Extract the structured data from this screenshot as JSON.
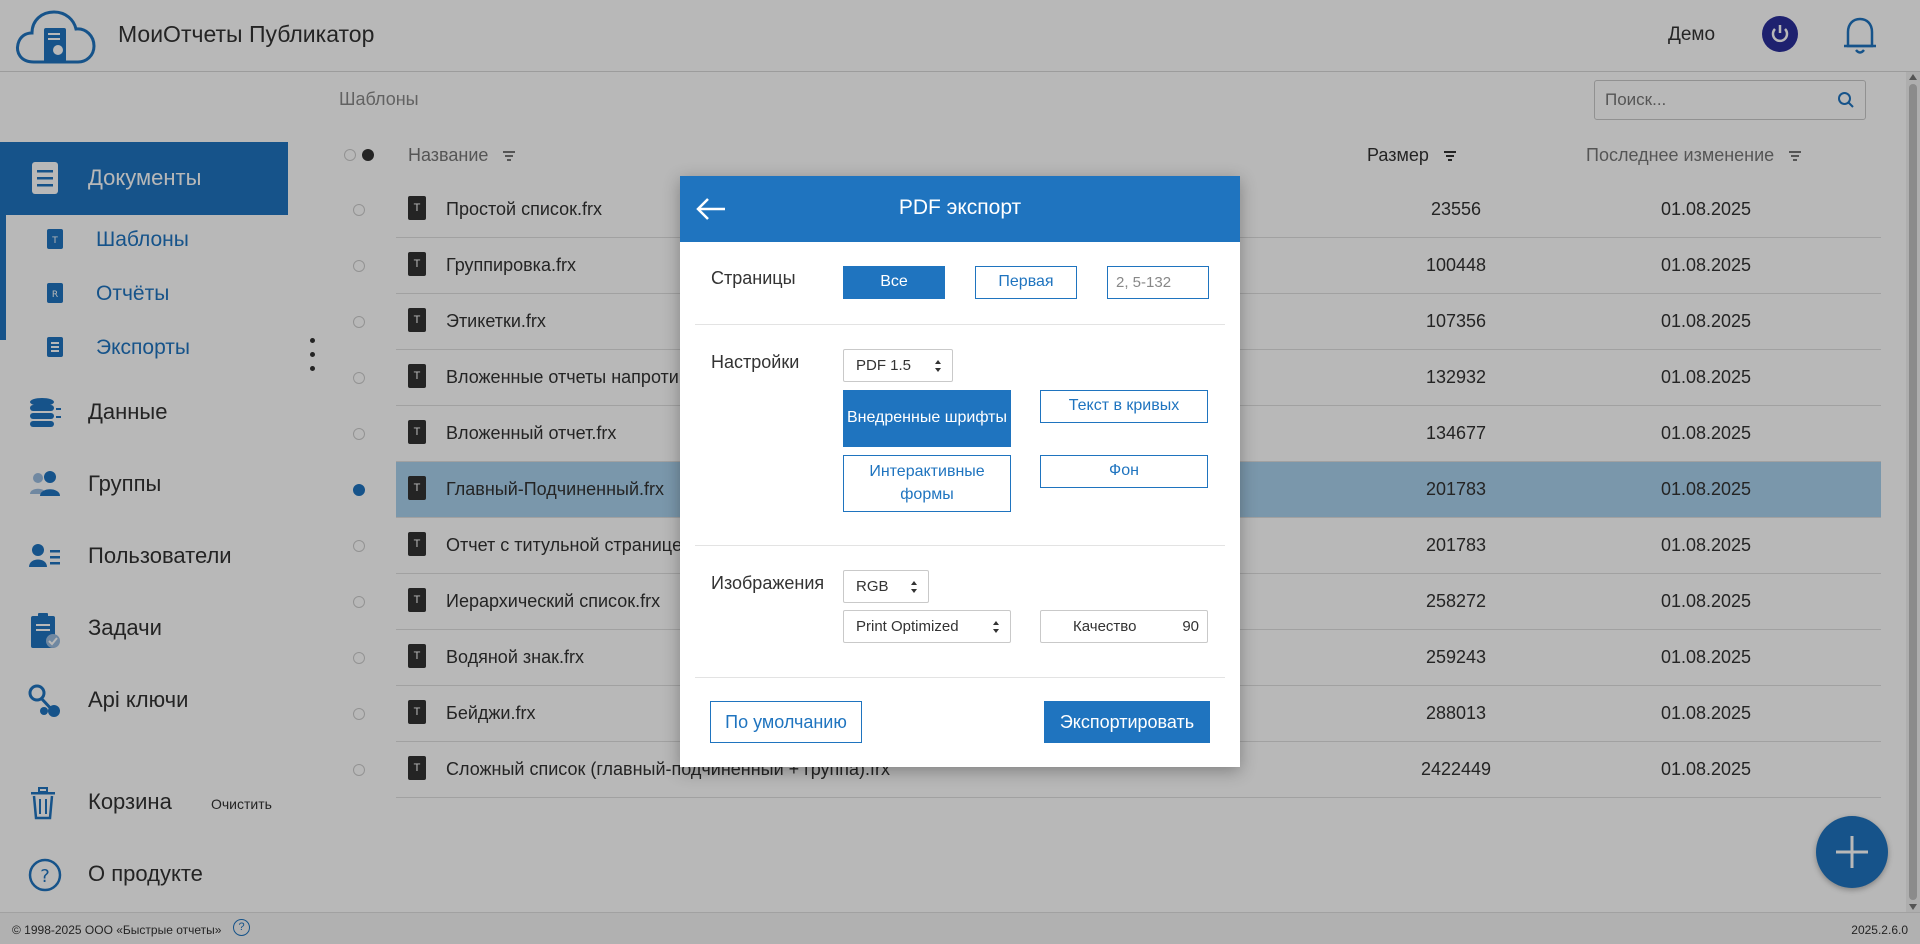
{
  "header": {
    "app_title": "МоиОтчеты Публикатор",
    "user_name": "Демо",
    "logo_icon": "cloud-document-logo",
    "power_icon": "power-icon",
    "bell_icon": "bell-icon"
  },
  "sidebar": {
    "documents_label": "Документы",
    "subitems": [
      {
        "label": "Шаблоны",
        "icon": "template-icon"
      },
      {
        "label": "Отчёты",
        "icon": "report-icon"
      },
      {
        "label": "Экспорты",
        "icon": "export-icon"
      }
    ],
    "items": [
      {
        "label": "Данные",
        "icon": "database-icon"
      },
      {
        "label": "Группы",
        "icon": "group-icon"
      },
      {
        "label": "Пользователи",
        "icon": "users-icon"
      },
      {
        "label": "Задачи",
        "icon": "tasks-icon"
      },
      {
        "label": "Api ключи",
        "icon": "api-key-icon"
      }
    ],
    "trash_label": "Корзина",
    "clear_label": "Очистить",
    "about_label": "О продукте"
  },
  "main": {
    "breadcrumb": "Шаблоны",
    "search_placeholder": "Поиск...",
    "columns": {
      "name": "Название",
      "size": "Размер",
      "modified": "Последнее изменение"
    },
    "rows": [
      {
        "type": "T",
        "name": "Простой список.frx",
        "size": "23556",
        "date": "01.08.2025"
      },
      {
        "type": "T",
        "name": "Группировка.frx",
        "size": "100448",
        "date": "01.08.2025"
      },
      {
        "type": "T",
        "name": "Этикетки.frx",
        "size": "107356",
        "date": "01.08.2025"
      },
      {
        "type": "T",
        "name": "Вложенные отчеты напроти",
        "size": "132932",
        "date": "01.08.2025"
      },
      {
        "type": "T",
        "name": "Вложенный отчет.frx",
        "size": "134677",
        "date": "01.08.2025"
      },
      {
        "type": "T",
        "name": "Главный-Подчиненный.frx",
        "size": "201783",
        "date": "01.08.2025"
      },
      {
        "type": "T",
        "name": "Отчет с титульной страницe",
        "size": "201783",
        "date": "01.08.2025"
      },
      {
        "type": "T",
        "name": "Иерархический список.frx",
        "size": "258272",
        "date": "01.08.2025"
      },
      {
        "type": "T",
        "name": "Водяной знак.frx",
        "size": "259243",
        "date": "01.08.2025"
      },
      {
        "type": "T",
        "name": "Бейджи.frx",
        "size": "288013",
        "date": "01.08.2025"
      },
      {
        "type": "T",
        "name": "Сложный список (главный-подчиненный + группа).frx",
        "size": "2422449",
        "date": "01.08.2025"
      }
    ],
    "selected_row": 5
  },
  "footer": {
    "copyright": "© 1998-2025 ООО «Быстрые отчеты»",
    "help": "?",
    "version": "2025.2.6.0"
  },
  "modal": {
    "title": "PDF экспорт",
    "pages_label": "Страницы",
    "pages_all": "Все",
    "pages_first": "Первая",
    "pages_range_placeholder": "2, 5-132",
    "settings_label": "Настройки",
    "pdf_version": "PDF 1.5",
    "embedded_fonts": "Внедренные шрифты",
    "text_curves": "Текст в кривых",
    "interactive_forms": "Интерактивные формы",
    "background": "Фон",
    "images_label": "Изображения",
    "color_space": "RGB",
    "optimization": "Print Optimized",
    "quality_label": "Качество",
    "quality_value": "90",
    "default_button": "По умолчанию",
    "export_button": "Экспортировать"
  },
  "colors": {
    "accent": "#1f74bf",
    "selected_row": "#a9d2ee",
    "power": "#2a2f9a"
  }
}
